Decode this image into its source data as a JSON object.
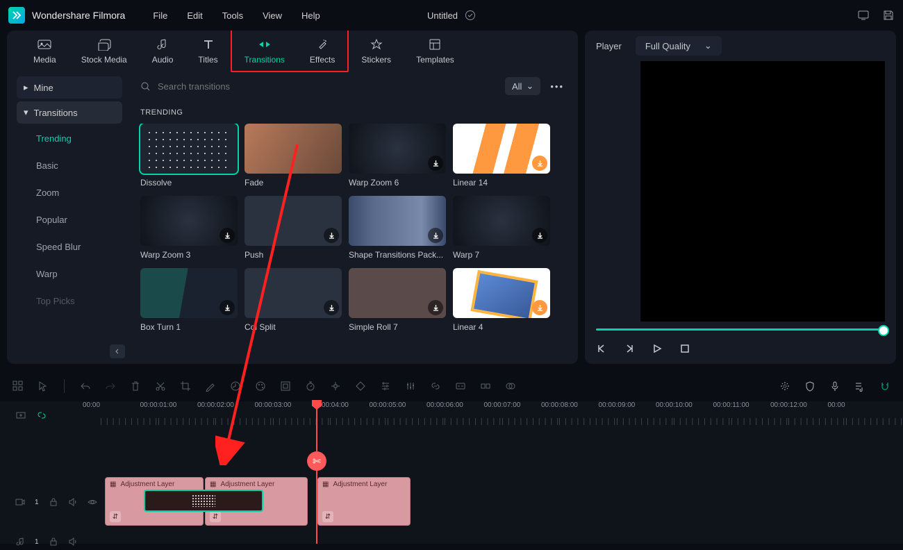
{
  "app": {
    "name": "Wondershare Filmora",
    "project_title": "Untitled"
  },
  "menu": [
    "File",
    "Edit",
    "Tools",
    "View",
    "Help"
  ],
  "tabs": [
    {
      "label": "Media"
    },
    {
      "label": "Stock Media"
    },
    {
      "label": "Audio"
    },
    {
      "label": "Titles"
    },
    {
      "label": "Transitions"
    },
    {
      "label": "Effects"
    },
    {
      "label": "Stickers"
    },
    {
      "label": "Templates"
    }
  ],
  "sidebar": {
    "mine": "Mine",
    "transitions": "Transitions",
    "subs": [
      "Trending",
      "Basic",
      "Zoom",
      "Popular",
      "Speed Blur",
      "Warp",
      "Top Picks"
    ]
  },
  "search": {
    "placeholder": "Search transitions"
  },
  "filter": {
    "label": "All"
  },
  "section": {
    "title": "TRENDING"
  },
  "cards": [
    {
      "label": "Dissolve",
      "cls": "th-dissolve",
      "dl": false,
      "selected": true
    },
    {
      "label": "Fade",
      "cls": "th-fade",
      "dl": false
    },
    {
      "label": "Warp Zoom 6",
      "cls": "th-warpzoom6",
      "dl": true
    },
    {
      "label": "Linear 14",
      "cls": "th-linear14",
      "dl": true,
      "accent": true
    },
    {
      "label": "Warp Zoom 3",
      "cls": "th-warpzoom3",
      "dl": true
    },
    {
      "label": "Push",
      "cls": "th-push",
      "dl": true
    },
    {
      "label": "Shape Transitions Pack...",
      "cls": "th-shape",
      "dl": true
    },
    {
      "label": "Warp 7",
      "cls": "th-warp7",
      "dl": true
    },
    {
      "label": "Box Turn 1",
      "cls": "th-boxturn",
      "dl": true
    },
    {
      "label": "Col Split",
      "cls": "th-colsplit",
      "dl": true
    },
    {
      "label": "Simple Roll 7",
      "cls": "th-simpleroll",
      "dl": true
    },
    {
      "label": "Linear 4",
      "cls": "th-linear4",
      "dl": true,
      "accent": true
    }
  ],
  "player": {
    "label": "Player",
    "quality": "Full Quality"
  },
  "timeline": {
    "marks": [
      "00:00",
      "00:00:01:00",
      "00:00:02:00",
      "00:00:03:00",
      "00:00:04:00",
      "00:00:05:00",
      "00:00:06:00",
      "00:00:07:00",
      "00:00:08:00",
      "00:00:09:00",
      "00:00:10:00",
      "00:00:11:00",
      "00:00:12:00",
      "00:00"
    ],
    "clip_label": "Adjustment Layer",
    "track1_num": "1",
    "track2_num": "1"
  }
}
